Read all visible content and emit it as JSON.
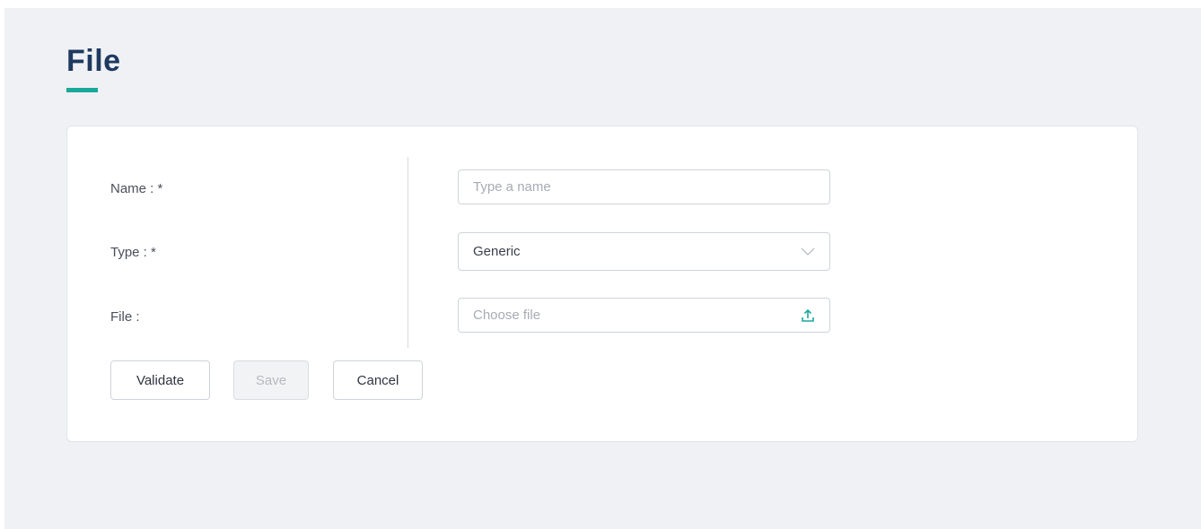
{
  "page": {
    "title": "File"
  },
  "form": {
    "name": {
      "label": "Name : *",
      "placeholder": "Type a name",
      "value": ""
    },
    "type": {
      "label": "Type : *",
      "value": "Generic",
      "icon": "chevron-down-icon"
    },
    "file": {
      "label": "File :",
      "placeholder": "Choose file",
      "icon": "upload-icon"
    }
  },
  "actions": {
    "validate_label": "Validate",
    "save_label": "Save",
    "cancel_label": "Cancel"
  },
  "colors": {
    "accent": "#1aa89a",
    "title": "#1f3a5f",
    "background": "#f0f1f5"
  }
}
